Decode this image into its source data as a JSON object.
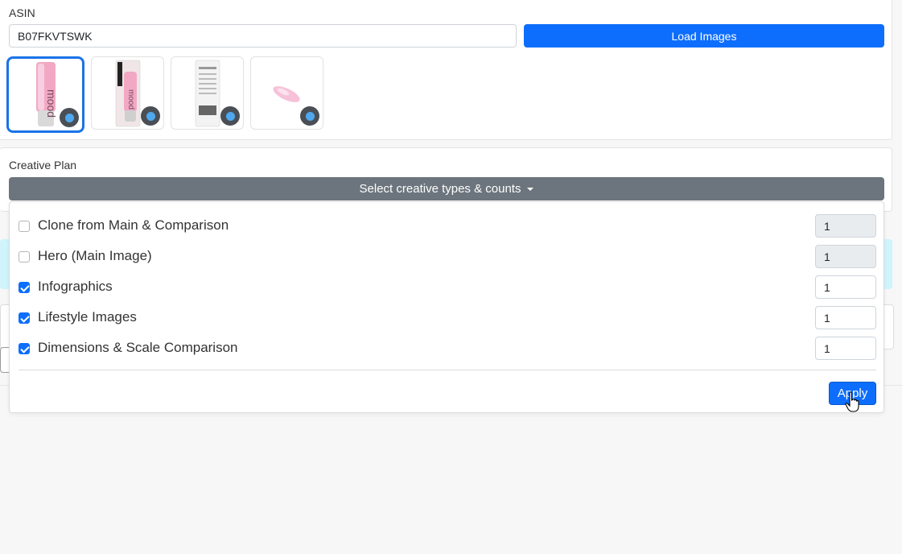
{
  "asin": {
    "label": "ASIN",
    "value": "B07FKVTSWK",
    "load_button": "Load Images",
    "thumbnails": [
      {
        "name": "product-image-1",
        "selected": true
      },
      {
        "name": "product-image-2",
        "selected": false
      },
      {
        "name": "product-image-3",
        "selected": false
      },
      {
        "name": "product-image-4",
        "selected": false
      }
    ]
  },
  "creative_plan": {
    "label": "Creative Plan",
    "dropdown_label": "Select creative types & counts",
    "items": [
      {
        "label": "Clone from Main & Comparison",
        "checked": false,
        "count": "1",
        "disabled": true
      },
      {
        "label": "Hero (Main Image)",
        "checked": false,
        "count": "1",
        "disabled": true
      },
      {
        "label": "Infographics",
        "checked": true,
        "count": "1",
        "disabled": false
      },
      {
        "label": "Lifestyle Images",
        "checked": true,
        "count": "1",
        "disabled": false
      },
      {
        "label": "Dimensions & Scale Comparison",
        "checked": true,
        "count": "1",
        "disabled": false
      }
    ],
    "apply_button": "Apply"
  },
  "colors": {
    "primary": "#0d6efd",
    "secondary": "#6c757d",
    "selected_thumb_border": "#1a73e8"
  }
}
